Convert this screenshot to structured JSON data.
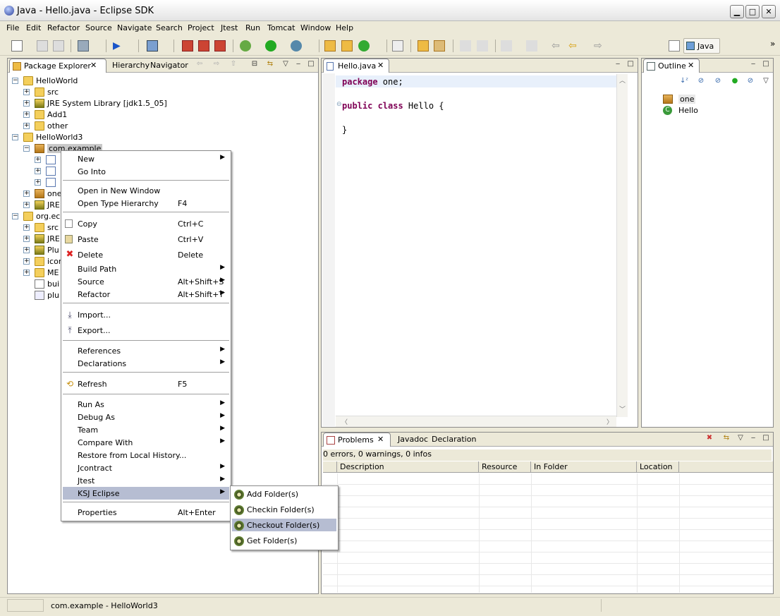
{
  "window": {
    "title": "Java - Hello.java - Eclipse SDK"
  },
  "menubar": [
    "File",
    "Edit",
    "Refactor",
    "Source",
    "Navigate",
    "Search",
    "Project",
    "Jtest",
    "Run",
    "Tomcat",
    "Window",
    "Help"
  ],
  "perspective": {
    "label": "Java"
  },
  "left_pane": {
    "tabs": [
      "Package Explorer",
      "Hierarchy",
      "Navigator"
    ],
    "tree": [
      {
        "label": "HelloWorld",
        "icon": "project-icon"
      },
      {
        "label": "src",
        "icon": "source-folder-icon"
      },
      {
        "label": "JRE System Library [jdk1.5_05]",
        "icon": "library-icon"
      },
      {
        "label": "Add1",
        "icon": "folder-icon"
      },
      {
        "label": "other",
        "icon": "folder-icon"
      },
      {
        "label": "HelloWorld3",
        "icon": "project-icon"
      },
      {
        "label": "com.example",
        "icon": "package-icon"
      },
      {
        "label": "one",
        "icon": "package-icon"
      },
      {
        "label": "JRE",
        "icon": "library-icon"
      },
      {
        "label": "org.ecl",
        "icon": "project-icon"
      },
      {
        "label": "src",
        "icon": "source-folder-icon"
      },
      {
        "label": "JRE",
        "icon": "library-icon"
      },
      {
        "label": "Plu",
        "icon": "library-icon"
      },
      {
        "label": "icor",
        "icon": "folder-icon"
      },
      {
        "label": "ME",
        "icon": "folder-icon"
      },
      {
        "label": "bui",
        "icon": "file-icon"
      },
      {
        "label": "plu",
        "icon": "file-icon"
      }
    ]
  },
  "context_menu": {
    "items": [
      {
        "label": "New",
        "submenu": true
      },
      {
        "label": "Go Into"
      },
      {
        "label": "Open in New Window"
      },
      {
        "label": "Open Type Hierarchy",
        "shortcut": "F4"
      },
      {
        "label": "Copy",
        "shortcut": "Ctrl+C",
        "icon": "copy-icon"
      },
      {
        "label": "Paste",
        "shortcut": "Ctrl+V",
        "icon": "paste-icon"
      },
      {
        "label": "Delete",
        "shortcut": "Delete",
        "icon": "delete-icon"
      },
      {
        "label": "Build Path",
        "submenu": true
      },
      {
        "label": "Source",
        "shortcut": "Alt+Shift+S",
        "submenu": true
      },
      {
        "label": "Refactor",
        "shortcut": "Alt+Shift+T",
        "submenu": true
      },
      {
        "label": "Import...",
        "icon": "import-icon"
      },
      {
        "label": "Export...",
        "icon": "export-icon"
      },
      {
        "label": "References",
        "submenu": true
      },
      {
        "label": "Declarations",
        "submenu": true
      },
      {
        "label": "Refresh",
        "shortcut": "F5",
        "icon": "refresh-icon"
      },
      {
        "label": "Run As",
        "submenu": true
      },
      {
        "label": "Debug As",
        "submenu": true
      },
      {
        "label": "Team",
        "submenu": true
      },
      {
        "label": "Compare With",
        "submenu": true
      },
      {
        "label": "Restore from Local History..."
      },
      {
        "label": "Jcontract",
        "submenu": true
      },
      {
        "label": "Jtest",
        "submenu": true
      },
      {
        "label": "KSJ Eclipse",
        "submenu": true,
        "highlighted": true
      },
      {
        "label": "Properties",
        "shortcut": "Alt+Enter"
      }
    ]
  },
  "submenu": {
    "items": [
      {
        "label": "Add Folder(s)"
      },
      {
        "label": "Checkin Folder(s)"
      },
      {
        "label": "Checkout Folder(s)",
        "highlighted": true
      },
      {
        "label": "Get Folder(s)"
      }
    ]
  },
  "editor": {
    "tab": "Hello.java",
    "lines": [
      {
        "kw": "package",
        "rest": " one;"
      },
      {
        "kw": "public class",
        "rest": " Hello {"
      },
      {
        "kw": "",
        "rest": "}"
      }
    ]
  },
  "outline": {
    "tab": "Outline",
    "items": [
      {
        "label": "one",
        "icon": "package-icon"
      },
      {
        "label": "Hello",
        "icon": "class-icon"
      }
    ]
  },
  "bottom_pane": {
    "tabs": [
      "Problems",
      "Javadoc",
      "Declaration"
    ],
    "summary": "0 errors, 0 warnings, 0 infos",
    "columns": [
      "Description",
      "Resource",
      "In Folder",
      "Location"
    ]
  },
  "status": {
    "text": "com.example - HelloWorld3"
  }
}
